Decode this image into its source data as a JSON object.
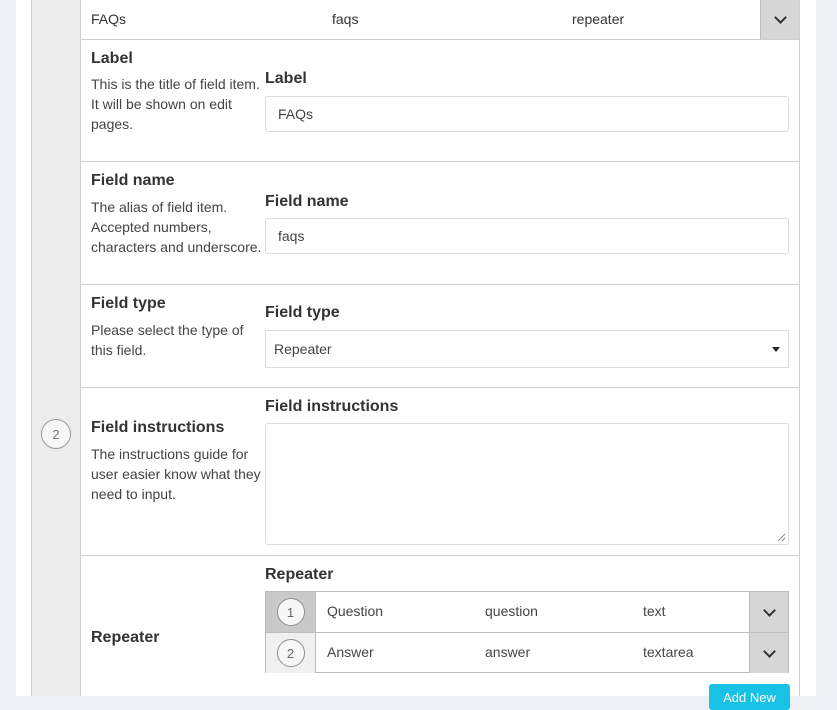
{
  "field_row": {
    "number": "2",
    "label": "FAQs",
    "name": "faqs",
    "type": "repeater"
  },
  "sections": {
    "label": {
      "title": "Label",
      "description": "This is the title of field item. It will be shown on edit pages.",
      "field_label": "Label",
      "value": "FAQs"
    },
    "field_name": {
      "title": "Field name",
      "description": "The alias of field item. Accepted numbers, characters and underscore.",
      "field_label": "Field name",
      "value": "faqs"
    },
    "field_type": {
      "title": "Field type",
      "description": "Please select the type of this field.",
      "field_label": "Field type",
      "selected": "Repeater"
    },
    "field_instructions": {
      "title": "Field instructions",
      "description": "The instructions guide for user easier know what they need to input.",
      "field_label": "Field instructions",
      "value": ""
    },
    "repeater": {
      "title": "Repeater",
      "field_label": "Repeater",
      "rows": [
        {
          "number": "1",
          "label": "Question",
          "name": "question",
          "type": "text"
        },
        {
          "number": "2",
          "label": "Answer",
          "name": "answer",
          "type": "textarea"
        }
      ],
      "add_button_label": "Add New"
    }
  },
  "colors": {
    "accent": "#17c2e6",
    "gutter": "#ececec",
    "border": "#cfcfcf",
    "toggle": "#d6d6d6"
  }
}
